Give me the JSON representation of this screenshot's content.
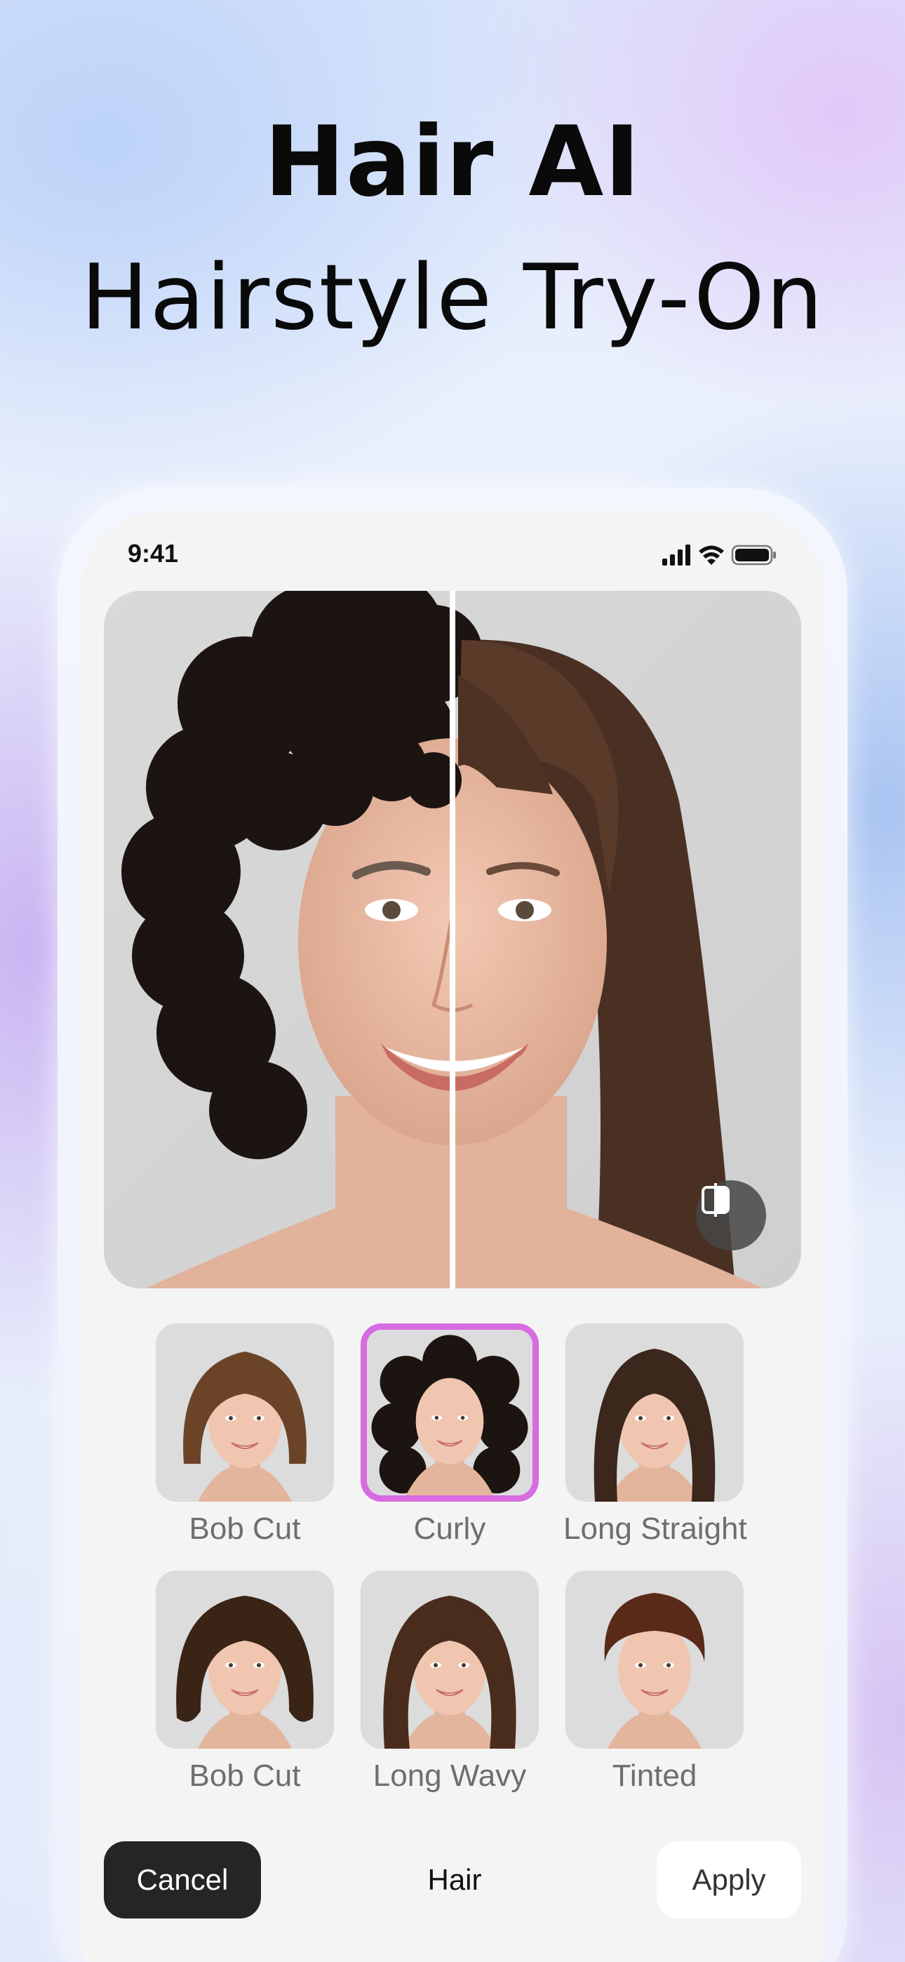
{
  "header": {
    "line1": "Hair AI",
    "line2": "Hairstyle Try-On"
  },
  "status_bar": {
    "time": "9:41",
    "icons": [
      "signal-icon",
      "wifi-icon",
      "battery-icon"
    ]
  },
  "preview": {
    "left_style": "Curly",
    "right_style": "Long Straight",
    "compare_icon": "compare-icon"
  },
  "styles": [
    {
      "label": "Bob Cut",
      "hair_color": "#6b4428",
      "shape": "bob",
      "selected": false
    },
    {
      "label": "Curly",
      "hair_color": "#1c1410",
      "shape": "curly",
      "selected": true
    },
    {
      "label": "Long Straight",
      "hair_color": "#3b271c",
      "shape": "long",
      "selected": false
    },
    {
      "label": "Bob Cut",
      "hair_color": "#3a2416",
      "shape": "wavybob",
      "selected": false
    },
    {
      "label": "Long Wavy",
      "hair_color": "#4a2c1d",
      "shape": "wavy",
      "selected": false
    },
    {
      "label": "Tinted",
      "hair_color": "#5a2a18",
      "shape": "pixie",
      "selected": false
    }
  ],
  "bottom_bar": {
    "cancel_label": "Cancel",
    "title": "Hair",
    "apply_label": "Apply"
  },
  "colors": {
    "accent": "#d76be0",
    "cancel_bg": "#252525"
  }
}
